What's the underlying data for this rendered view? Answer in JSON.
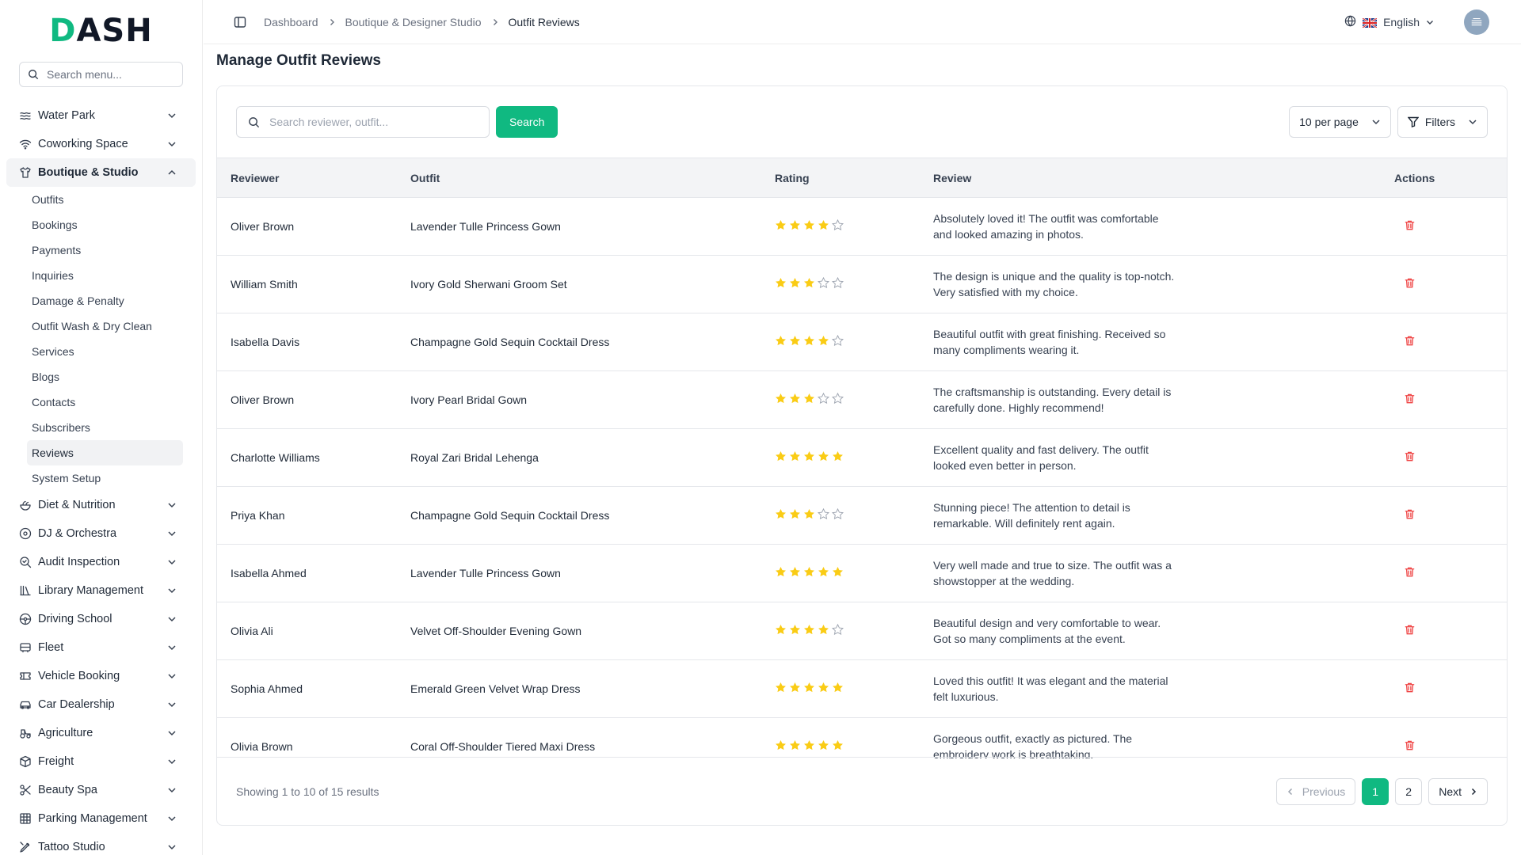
{
  "brand": {
    "logo_d": "D",
    "logo_rest": "ASH"
  },
  "sidebar": {
    "search_placeholder": "Search menu...",
    "items_top": [
      {
        "label": "Water Park",
        "icon": "waves-icon"
      },
      {
        "label": "Coworking Space",
        "icon": "wifi-icon"
      }
    ],
    "active_group": {
      "label": "Boutique & Studio",
      "icon": "shirt-icon"
    },
    "submenu": [
      "Outfits",
      "Bookings",
      "Payments",
      "Inquiries",
      "Damage & Penalty",
      "Outfit Wash & Dry Clean",
      "Services",
      "Blogs",
      "Contacts",
      "Subscribers",
      "Reviews",
      "System Setup"
    ],
    "active_sub": "Reviews",
    "items_bottom": [
      {
        "label": "Diet & Nutrition",
        "icon": "salad-icon"
      },
      {
        "label": "DJ & Orchestra",
        "icon": "disc-icon"
      },
      {
        "label": "Audit Inspection",
        "icon": "search-check-icon"
      },
      {
        "label": "Library Management",
        "icon": "library-icon"
      },
      {
        "label": "Driving School",
        "icon": "steering-icon"
      },
      {
        "label": "Fleet",
        "icon": "bus-icon"
      },
      {
        "label": "Vehicle Booking",
        "icon": "ticket-icon"
      },
      {
        "label": "Car Dealership",
        "icon": "car-icon"
      },
      {
        "label": "Agriculture",
        "icon": "tractor-icon"
      },
      {
        "label": "Freight",
        "icon": "package-icon"
      },
      {
        "label": "Beauty Spa",
        "icon": "scissors-icon"
      },
      {
        "label": "Parking Management",
        "icon": "grid-icon"
      },
      {
        "label": "Tattoo Studio",
        "icon": "pen-tool-icon"
      }
    ]
  },
  "topbar": {
    "breadcrumbs": [
      "Dashboard",
      "Boutique & Designer Studio",
      "Outfit Reviews"
    ],
    "language": "English"
  },
  "page": {
    "title": "Manage Outfit Reviews"
  },
  "toolbar": {
    "search_placeholder": "Search reviewer, outfit...",
    "search_button": "Search",
    "per_page": "10 per page",
    "filters": "Filters"
  },
  "table": {
    "headers": {
      "reviewer": "Reviewer",
      "outfit": "Outfit",
      "rating": "Rating",
      "review": "Review",
      "actions": "Actions"
    },
    "rows": [
      {
        "reviewer": "Oliver Brown",
        "outfit": "Lavender Tulle Princess Gown",
        "rating": 4,
        "review": "Absolutely loved it! The outfit was comfortable and looked amazing in photos."
      },
      {
        "reviewer": "William Smith",
        "outfit": "Ivory Gold Sherwani Groom Set",
        "rating": 3,
        "review": "The design is unique and the quality is top-notch. Very satisfied with my choice."
      },
      {
        "reviewer": "Isabella Davis",
        "outfit": "Champagne Gold Sequin Cocktail Dress",
        "rating": 4,
        "review": "Beautiful outfit with great finishing. Received so many compliments wearing it."
      },
      {
        "reviewer": "Oliver Brown",
        "outfit": "Ivory Pearl Bridal Gown",
        "rating": 3,
        "review": "The craftsmanship is outstanding. Every detail is carefully done. Highly recommend!"
      },
      {
        "reviewer": "Charlotte Williams",
        "outfit": "Royal Zari Bridal Lehenga",
        "rating": 5,
        "review": "Excellent quality and fast delivery. The outfit looked even better in person."
      },
      {
        "reviewer": "Priya Khan",
        "outfit": "Champagne Gold Sequin Cocktail Dress",
        "rating": 3,
        "review": "Stunning piece! The attention to detail is remarkable. Will definitely rent again."
      },
      {
        "reviewer": "Isabella Ahmed",
        "outfit": "Lavender Tulle Princess Gown",
        "rating": 5,
        "review": "Very well made and true to size. The outfit was a showstopper at the wedding."
      },
      {
        "reviewer": "Olivia Ali",
        "outfit": "Velvet Off-Shoulder Evening Gown",
        "rating": 4,
        "review": "Beautiful design and very comfortable to wear. Got so many compliments at the event."
      },
      {
        "reviewer": "Sophia Ahmed",
        "outfit": "Emerald Green Velvet Wrap Dress",
        "rating": 5,
        "review": "Loved this outfit! It was elegant and the material felt luxurious."
      },
      {
        "reviewer": "Olivia Brown",
        "outfit": "Coral Off-Shoulder Tiered Maxi Dress",
        "rating": 5,
        "review": "Gorgeous outfit, exactly as pictured. The embroidery work is breathtaking."
      }
    ]
  },
  "footer": {
    "showing": "Showing 1 to 10 of 15 results",
    "previous": "Previous",
    "pages": [
      "1",
      "2"
    ],
    "next": "Next"
  },
  "colors": {
    "accent": "#10b981",
    "star": "#facc15",
    "danger": "#ef4444"
  }
}
